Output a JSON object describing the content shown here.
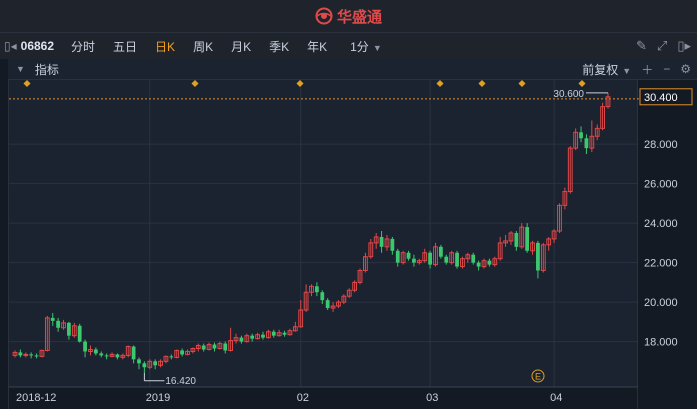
{
  "app": {
    "brand": "华盛通"
  },
  "toolbar": {
    "code": "06862",
    "periods": [
      "分时",
      "五日",
      "日K",
      "周K",
      "月K",
      "季K",
      "年K"
    ],
    "active_period": "日K",
    "minute_selector": "1分"
  },
  "indicator_bar": {
    "label": "指标",
    "adjust": "前复权"
  },
  "chart_data": {
    "type": "candlestick",
    "y_ticks": [
      "30.400",
      "28.000",
      "26.000",
      "24.000",
      "22.000",
      "20.000",
      "18.000"
    ],
    "y_tick_values": [
      30.4,
      28,
      26,
      24,
      22,
      20,
      18
    ],
    "ylim": [
      15.7,
      31.25
    ],
    "x_labels": [
      "2018-12",
      "2019",
      "02",
      "03",
      "04"
    ],
    "x_label_index": [
      0,
      25,
      53,
      77,
      100
    ],
    "current_price": "30.400",
    "max_label": "30.600",
    "max_value": 30.6,
    "min_label": "16.420",
    "min_value": 16.42,
    "event_marker": "E",
    "up_color": "#e04848",
    "down_color": "#3cc86e",
    "candles": [
      [
        17.3,
        17.45,
        17.55,
        17.2
      ],
      [
        17.45,
        17.3,
        17.6,
        17.2
      ],
      [
        17.3,
        17.35,
        17.45,
        17.2
      ],
      [
        17.35,
        17.3,
        17.45,
        17.15
      ],
      [
        17.3,
        17.25,
        17.4,
        17.15
      ],
      [
        17.25,
        17.55,
        17.6,
        17.2
      ],
      [
        17.55,
        19.2,
        19.3,
        17.5
      ],
      [
        19.2,
        19.05,
        19.45,
        18.8
      ],
      [
        19.05,
        18.7,
        19.2,
        18.5
      ],
      [
        18.7,
        18.95,
        19.1,
        18.6
      ],
      [
        18.95,
        18.3,
        19.0,
        18.1
      ],
      [
        18.3,
        18.8,
        18.95,
        18.2
      ],
      [
        18.8,
        18.0,
        18.9,
        17.95
      ],
      [
        18.0,
        17.5,
        18.1,
        17.2
      ],
      [
        17.5,
        17.6,
        17.8,
        17.3
      ],
      [
        17.6,
        17.4,
        17.7,
        17.3
      ],
      [
        17.4,
        17.3,
        17.5,
        17.2
      ],
      [
        17.3,
        17.25,
        17.4,
        17.1
      ],
      [
        17.25,
        17.35,
        17.45,
        17.2
      ],
      [
        17.35,
        17.2,
        17.4,
        17.1
      ],
      [
        17.2,
        17.3,
        17.4,
        17.1
      ],
      [
        17.3,
        17.75,
        17.8,
        17.2
      ],
      [
        17.75,
        17.1,
        17.8,
        16.9
      ],
      [
        17.1,
        16.9,
        17.2,
        16.6
      ],
      [
        16.9,
        16.7,
        17.0,
        16.42
      ],
      [
        16.7,
        17.0,
        17.1,
        16.6
      ],
      [
        17.0,
        16.8,
        17.1,
        16.6
      ],
      [
        16.8,
        17.0,
        17.1,
        16.7
      ],
      [
        17.0,
        17.25,
        17.3,
        16.9
      ],
      [
        17.25,
        17.2,
        17.35,
        17.1
      ],
      [
        17.2,
        17.55,
        17.6,
        17.15
      ],
      [
        17.55,
        17.35,
        17.65,
        17.25
      ],
      [
        17.35,
        17.5,
        17.6,
        17.3
      ],
      [
        17.5,
        17.65,
        17.7,
        17.4
      ],
      [
        17.65,
        17.8,
        17.9,
        17.5
      ],
      [
        17.8,
        17.6,
        17.9,
        17.5
      ],
      [
        17.6,
        17.85,
        17.95,
        17.55
      ],
      [
        17.85,
        17.65,
        17.95,
        17.5
      ],
      [
        17.65,
        17.9,
        18.0,
        17.6
      ],
      [
        17.9,
        17.55,
        18.0,
        17.4
      ],
      [
        17.55,
        18.05,
        18.7,
        17.5
      ],
      [
        18.05,
        18.2,
        18.4,
        17.9
      ],
      [
        18.2,
        18.0,
        18.3,
        17.9
      ],
      [
        18.0,
        18.3,
        18.4,
        17.95
      ],
      [
        18.3,
        18.15,
        18.4,
        18.0
      ],
      [
        18.15,
        18.35,
        18.45,
        18.1
      ],
      [
        18.35,
        18.2,
        18.5,
        18.1
      ],
      [
        18.2,
        18.5,
        18.6,
        18.15
      ],
      [
        18.5,
        18.3,
        18.6,
        18.2
      ],
      [
        18.3,
        18.45,
        18.6,
        18.25
      ],
      [
        18.45,
        18.35,
        18.55,
        18.25
      ],
      [
        18.35,
        18.55,
        18.65,
        18.3
      ],
      [
        18.55,
        18.75,
        19.0,
        18.5
      ],
      [
        18.75,
        19.6,
        20.1,
        18.7
      ],
      [
        19.6,
        20.5,
        20.9,
        19.5
      ],
      [
        20.5,
        20.8,
        20.9,
        20.3
      ],
      [
        20.8,
        20.5,
        21.0,
        20.3
      ],
      [
        20.5,
        20.1,
        20.6,
        19.9
      ],
      [
        20.1,
        19.7,
        20.2,
        19.6
      ],
      [
        19.7,
        19.8,
        20.0,
        19.5
      ],
      [
        19.8,
        20.0,
        20.1,
        19.7
      ],
      [
        20.0,
        20.3,
        20.4,
        19.9
      ],
      [
        20.3,
        20.6,
        20.7,
        20.2
      ],
      [
        20.6,
        21.0,
        21.1,
        20.5
      ],
      [
        21.0,
        21.6,
        21.7,
        20.9
      ],
      [
        21.6,
        22.3,
        22.5,
        21.5
      ],
      [
        22.3,
        23.0,
        23.2,
        22.2
      ],
      [
        23.0,
        23.3,
        23.5,
        22.7
      ],
      [
        23.3,
        22.8,
        23.6,
        22.5
      ],
      [
        22.8,
        23.2,
        23.4,
        22.6
      ],
      [
        23.2,
        22.6,
        23.3,
        22.4
      ],
      [
        22.6,
        22.0,
        22.7,
        21.8
      ],
      [
        22.0,
        22.5,
        22.6,
        21.9
      ],
      [
        22.5,
        22.2,
        22.6,
        22.1
      ],
      [
        22.2,
        22.0,
        22.4,
        21.8
      ],
      [
        22.0,
        22.1,
        22.2,
        21.9
      ],
      [
        22.1,
        22.5,
        22.7,
        22.0
      ],
      [
        22.5,
        21.9,
        22.6,
        21.7
      ],
      [
        21.9,
        22.8,
        23.0,
        21.8
      ],
      [
        22.8,
        22.3,
        22.9,
        22.2
      ],
      [
        22.3,
        22.0,
        22.4,
        21.9
      ],
      [
        22.0,
        22.5,
        22.6,
        21.9
      ],
      [
        22.5,
        21.8,
        22.6,
        21.7
      ],
      [
        21.8,
        22.2,
        22.3,
        21.7
      ],
      [
        22.2,
        22.4,
        22.5,
        22.0
      ],
      [
        22.4,
        22.0,
        22.5,
        21.9
      ],
      [
        22.0,
        21.8,
        22.1,
        21.6
      ],
      [
        21.8,
        22.1,
        22.2,
        21.7
      ],
      [
        22.1,
        21.9,
        22.2,
        21.8
      ],
      [
        21.9,
        22.2,
        22.3,
        21.8
      ],
      [
        22.2,
        23.0,
        23.3,
        22.1
      ],
      [
        23.0,
        23.1,
        23.4,
        22.8
      ],
      [
        23.1,
        23.5,
        23.6,
        22.9
      ],
      [
        23.5,
        22.8,
        23.6,
        22.6
      ],
      [
        22.8,
        23.8,
        24.0,
        22.7
      ],
      [
        23.8,
        22.6,
        24.0,
        22.5
      ],
      [
        22.6,
        23.0,
        23.1,
        22.4
      ],
      [
        23.0,
        21.6,
        23.1,
        21.2
      ],
      [
        21.6,
        22.9,
        23.0,
        21.5
      ],
      [
        22.9,
        23.2,
        23.3,
        22.6
      ],
      [
        23.2,
        23.6,
        23.7,
        23.0
      ],
      [
        23.6,
        24.9,
        25.0,
        23.5
      ],
      [
        24.9,
        25.6,
        25.8,
        24.7
      ],
      [
        25.6,
        27.8,
        27.9,
        25.5
      ],
      [
        27.8,
        28.6,
        28.8,
        27.7
      ],
      [
        28.6,
        28.3,
        28.9,
        28.1
      ],
      [
        28.3,
        27.8,
        28.5,
        27.5
      ],
      [
        27.8,
        28.4,
        29.2,
        27.6
      ],
      [
        28.4,
        28.8,
        29.0,
        28.2
      ],
      [
        28.8,
        29.9,
        30.1,
        28.7
      ],
      [
        29.9,
        30.4,
        30.6,
        29.8
      ]
    ]
  }
}
